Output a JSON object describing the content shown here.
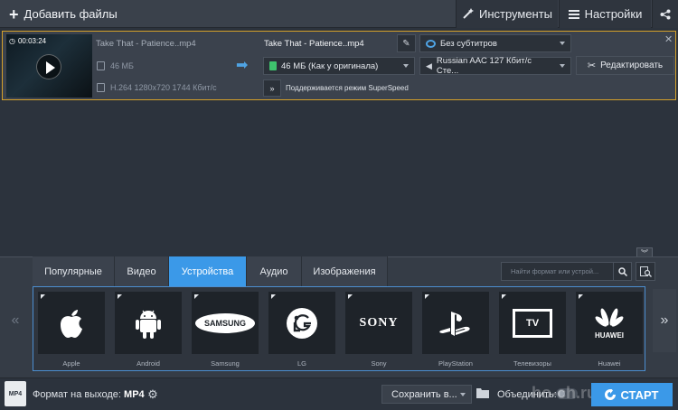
{
  "toolbar": {
    "add_files": "Добавить файлы",
    "tools": "Инструменты",
    "settings": "Настройки"
  },
  "file": {
    "duration": "00:03:24",
    "source_name": "Take That - Patience..mp4",
    "source_size": "46 МБ",
    "source_codec": "H.264 1280x720 1744 Кбит/с",
    "output_name": "Take That - Patience..mp4",
    "output_size": "46 МБ (Как у оригинала)",
    "superspeed": "Поддерживается режим SuperSpeed",
    "subtitles": "Без субтитров",
    "audio": "Russian AAC 127 Кбит/с Сте...",
    "edit": "Редактировать"
  },
  "tabs": [
    {
      "label": "Популярные",
      "active": false
    },
    {
      "label": "Видео",
      "active": false
    },
    {
      "label": "Устройства",
      "active": true
    },
    {
      "label": "Аудио",
      "active": false
    },
    {
      "label": "Изображения",
      "active": false
    }
  ],
  "search": {
    "placeholder": "Найти формат или устрой..."
  },
  "devices": [
    {
      "label": "Apple",
      "icon": "apple-logo-icon"
    },
    {
      "label": "Android",
      "icon": "android-logo-icon"
    },
    {
      "label": "Samsung",
      "icon": "samsung-logo-icon",
      "logo_text": "SAMSUNG"
    },
    {
      "label": "LG",
      "icon": "lg-logo-icon"
    },
    {
      "label": "Sony",
      "icon": "sony-logo-icon",
      "logo_text": "SONY"
    },
    {
      "label": "PlayStation",
      "icon": "playstation-logo-icon"
    },
    {
      "label": "Телевизоры",
      "icon": "tv-icon",
      "logo_text": "TV"
    },
    {
      "label": "Huawei",
      "icon": "huawei-logo-icon",
      "logo_text": "HUAWEI"
    }
  ],
  "status": {
    "format_label": "Формат на выходе:",
    "format_value": "MP4",
    "mp4_icon": "MP4",
    "save": "Сохранить в...",
    "merge": "Объединить:",
    "start": "СТАРТ",
    "watermark": "ho-ch.ru"
  },
  "colors": {
    "accent": "#3b99e8",
    "selection_border": "#d6a12a",
    "green": "#3ec46d"
  }
}
